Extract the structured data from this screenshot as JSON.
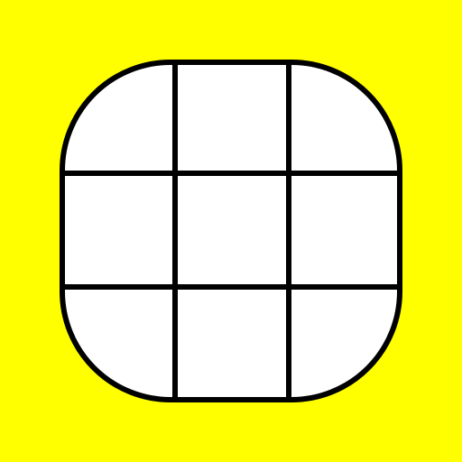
{
  "icon": {
    "name": "grid-3x3-icon",
    "rows": 3,
    "columns": 3
  },
  "colors": {
    "background": "#FFFF00",
    "tile_fill": "#FFFFFF",
    "stroke": "#000000"
  }
}
